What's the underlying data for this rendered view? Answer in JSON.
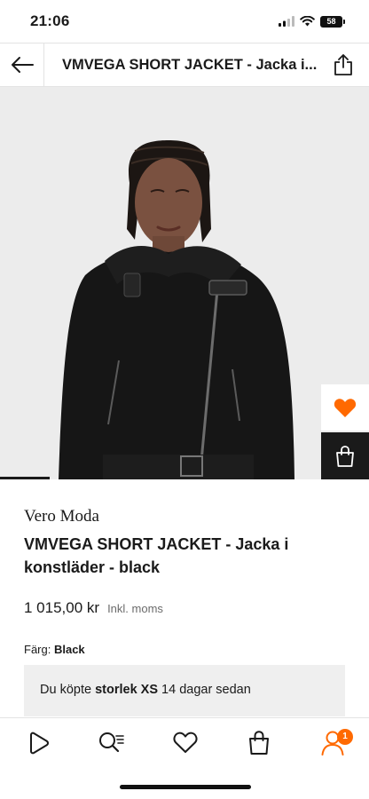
{
  "status_bar": {
    "time": "21:06",
    "battery": "58"
  },
  "header": {
    "title": "VMVEGA SHORT JACKET - Jacka i konstläder - black"
  },
  "product": {
    "brand": "Vero Moda",
    "name": "VMVEGA SHORT JACKET - Jacka i konstläder - black",
    "price": "1 015,00 kr",
    "price_note": "Inkl. moms",
    "color_label": "Färg:",
    "color_value": "Black"
  },
  "recent_purchase": {
    "prefix": "Du köpte",
    "size_label": "storlek XS",
    "suffix": "14 dagar sedan"
  },
  "tab_bar": {
    "profile_badge": "1"
  },
  "colors": {
    "accent": "#ff6900",
    "dark": "#1a1a1a",
    "image_bg": "#ececec"
  }
}
